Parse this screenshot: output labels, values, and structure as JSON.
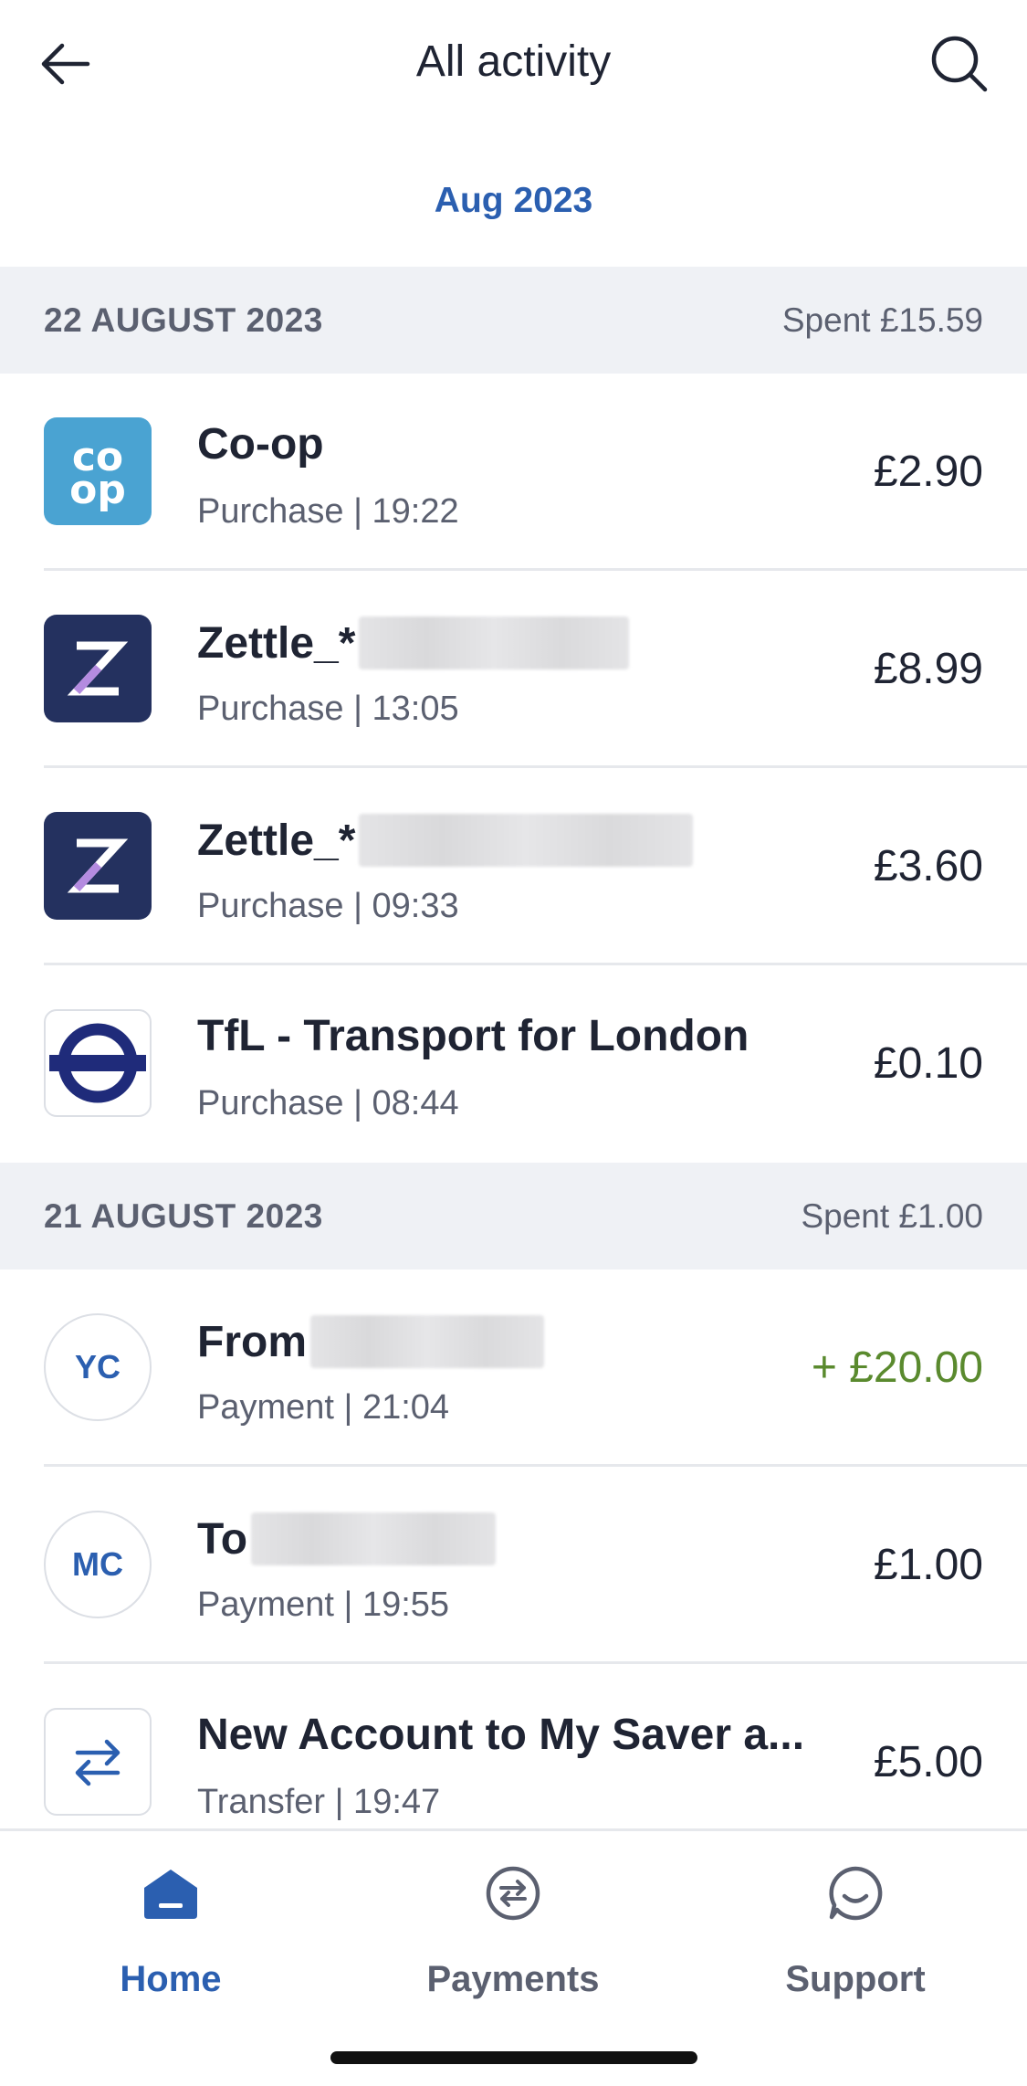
{
  "header": {
    "title": "All activity"
  },
  "month": "Aug 2023",
  "days": [
    {
      "date": "22 AUGUST 2023",
      "spent": "Spent £15.59",
      "transactions": [
        {
          "title": "Co-op",
          "subtitle": "Purchase | 19:22",
          "amount": "£2.90",
          "logo": "coop-logo"
        },
        {
          "title": "Zettle_*",
          "subtitle": "Purchase | 13:05",
          "amount": "£8.99",
          "logo": "zettle-logo"
        },
        {
          "title": "Zettle_*",
          "subtitle": "Purchase | 09:33",
          "amount": "£3.60",
          "logo": "zettle-logo"
        },
        {
          "title": "TfL - Transport for London",
          "subtitle": "Purchase | 08:44",
          "amount": "£0.10",
          "logo": "tfl-roundel-logo"
        }
      ]
    },
    {
      "date": "21 AUGUST 2023",
      "spent": "Spent £1.00",
      "transactions": [
        {
          "title": "From",
          "initials": "YC",
          "subtitle": "Payment | 21:04",
          "amount": "+ £20.00"
        },
        {
          "title": "To",
          "initials": "MC",
          "subtitle": "Payment | 19:55",
          "amount": "£1.00"
        },
        {
          "title": "New Account to My Saver a...",
          "subtitle": "Transfer | 19:47",
          "amount": "£5.00",
          "logo": "transfer-arrows-icon"
        }
      ]
    }
  ],
  "nav": [
    {
      "label": "Home",
      "icon": "home-icon",
      "active": true
    },
    {
      "label": "Payments",
      "icon": "payments-icon",
      "active": false
    },
    {
      "label": "Support",
      "icon": "support-icon",
      "active": false
    }
  ],
  "colors": {
    "accent": "#2b5fb0",
    "credit": "#5a8a2e",
    "section_bg": "#eff1f5"
  }
}
